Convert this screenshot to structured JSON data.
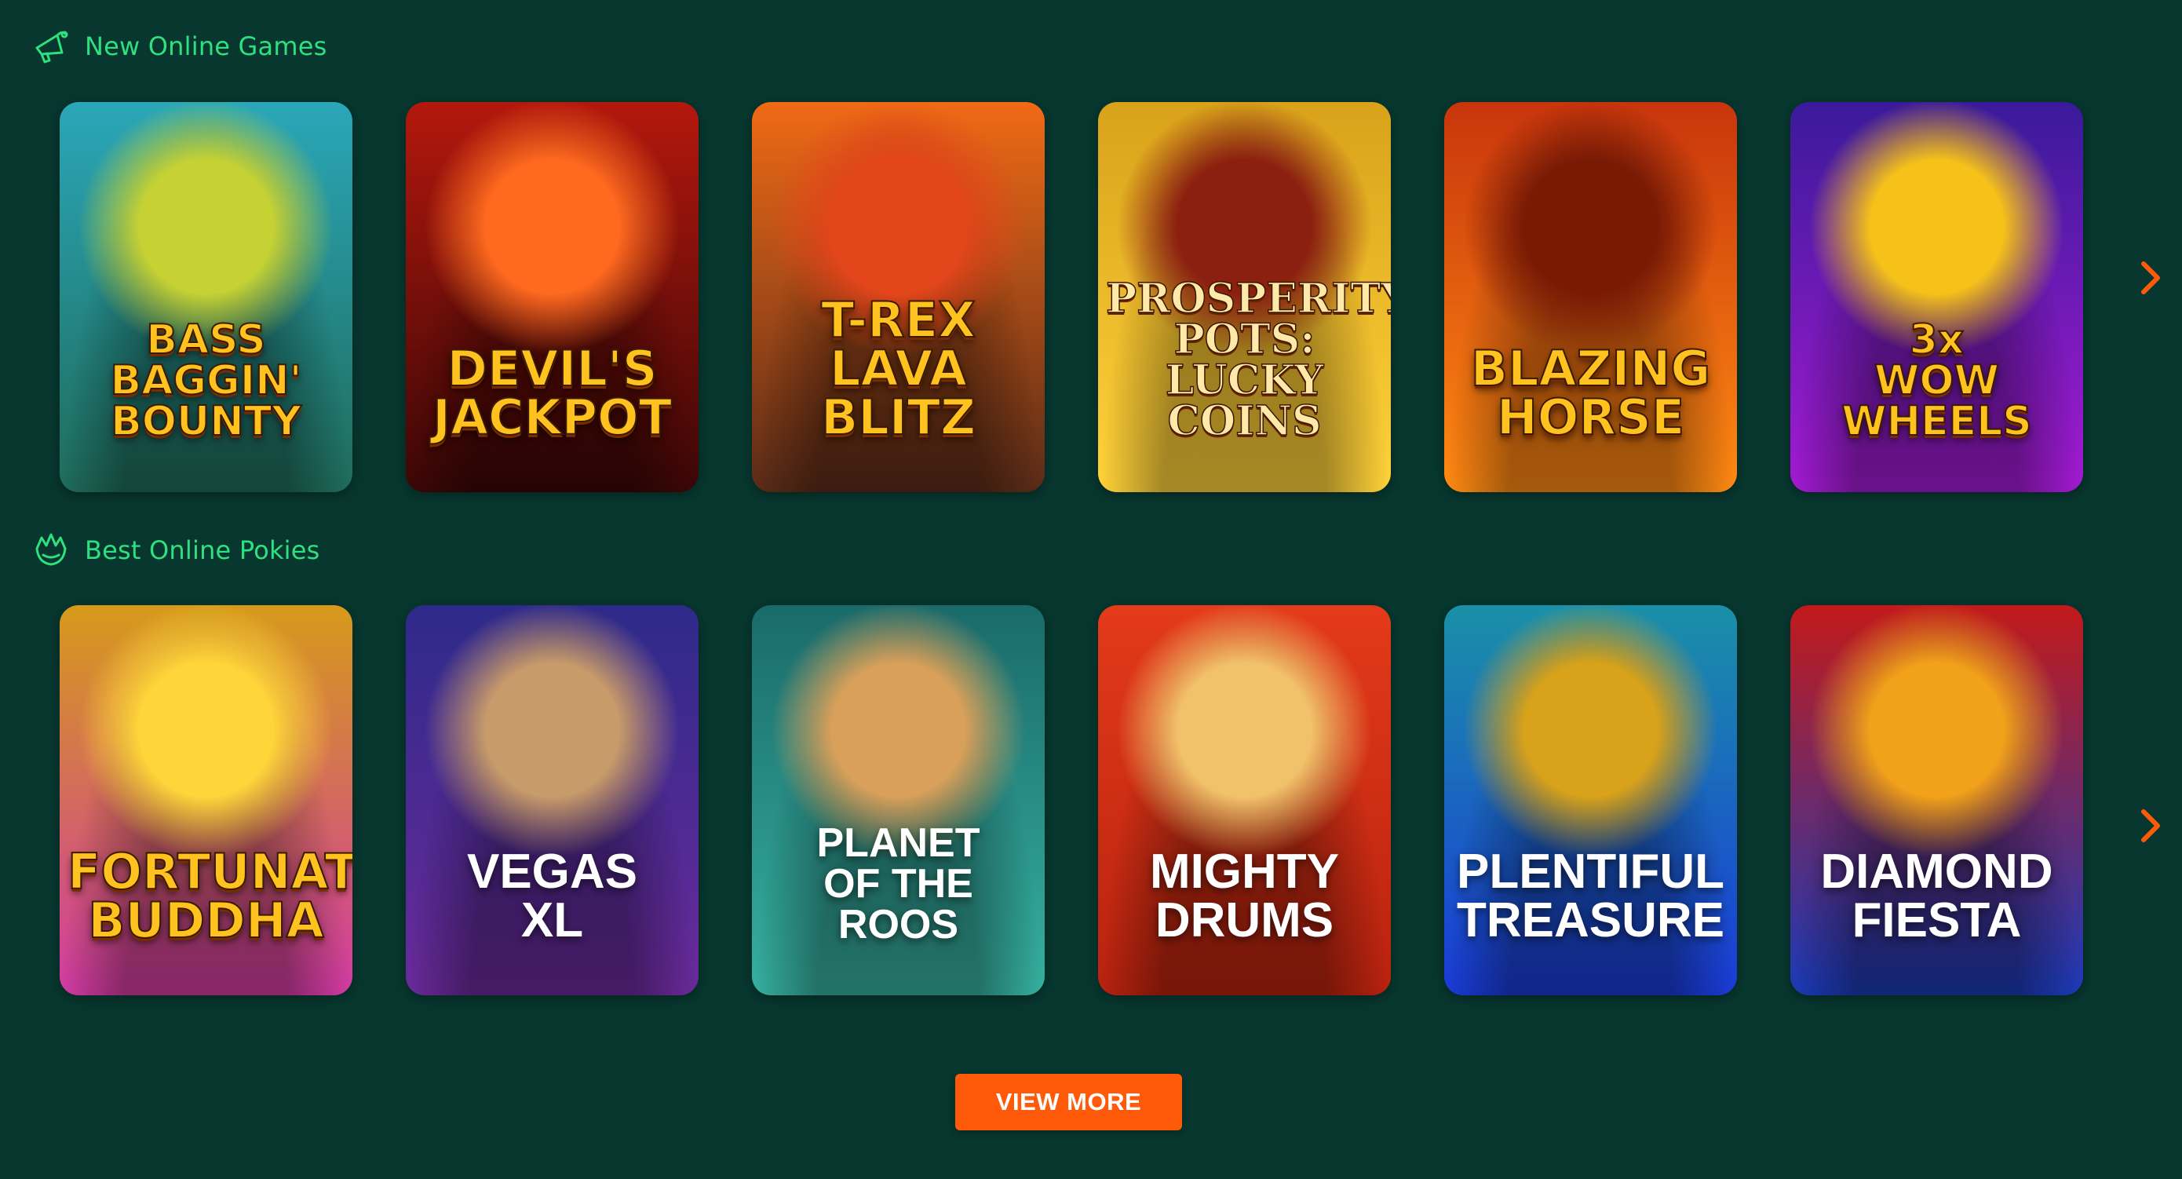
{
  "sections": [
    {
      "title": "New Online Games",
      "icon": "megaphone-icon",
      "games": [
        {
          "title": "BASS\nBAGGIN'\nBOUNTY",
          "bg_top": "#2aa7b8",
          "bg_bottom": "#1f6b5a",
          "accent": "#c6d233"
        },
        {
          "title": "DEVIL'S\nJACKPOT",
          "bg_top": "#b3180d",
          "bg_bottom": "#3b0606",
          "accent": "#ff6a1f"
        },
        {
          "title": "T-REX\nLAVA BLITZ",
          "bg_top": "#f06a16",
          "bg_bottom": "#5a2b18",
          "accent": "#e3461a"
        },
        {
          "title": "PROSPERITY\nPOTS:\nLUCKY COINS",
          "bg_top": "#d8a21a",
          "bg_bottom": "#ffd23a",
          "accent": "#8b1f10"
        },
        {
          "title": "BLAZING\nHORSE",
          "bg_top": "#c8350c",
          "bg_bottom": "#ff8a12",
          "accent": "#7a1a05"
        },
        {
          "title": "3x\nWOW\nWHEELS",
          "bg_top": "#3a1a9a",
          "bg_bottom": "#a31ad2",
          "accent": "#f6c21a"
        }
      ]
    },
    {
      "title": "Best Online Pokies",
      "icon": "crown-hand-icon",
      "games": [
        {
          "title": "FORTUNATE\nBUDDHA",
          "bg_top": "#d69a1a",
          "bg_bottom": "#d13aa3",
          "accent": "#ffd63a"
        },
        {
          "title": "VEGAS\nXL",
          "bg_top": "#2e2a8a",
          "bg_bottom": "#6a2a9a",
          "accent": "#c89b6a"
        },
        {
          "title": "PLANET\nOF THE\nROOS",
          "bg_top": "#1a6a6a",
          "bg_bottom": "#36b0a0",
          "accent": "#d8a05a"
        },
        {
          "title": "MIGHTY\nDRUMS",
          "bg_top": "#e33a1a",
          "bg_bottom": "#b8220e",
          "accent": "#f2c26a"
        },
        {
          "title": "PLENTIFUL\nTREASURE",
          "bg_top": "#1a90a8",
          "bg_bottom": "#1a3ad8",
          "accent": "#d8a21a"
        },
        {
          "title": "DIAMOND\nFIESTA",
          "bg_top": "#c21a1a",
          "bg_bottom": "#1a3ab8",
          "accent": "#f2a21a"
        }
      ]
    }
  ],
  "next_icon": "chevron-right-icon",
  "view_more_label": "VIEW MORE",
  "colors": {
    "background": "#07372f",
    "heading": "#2fe07e",
    "accent": "#ff5a0a"
  }
}
